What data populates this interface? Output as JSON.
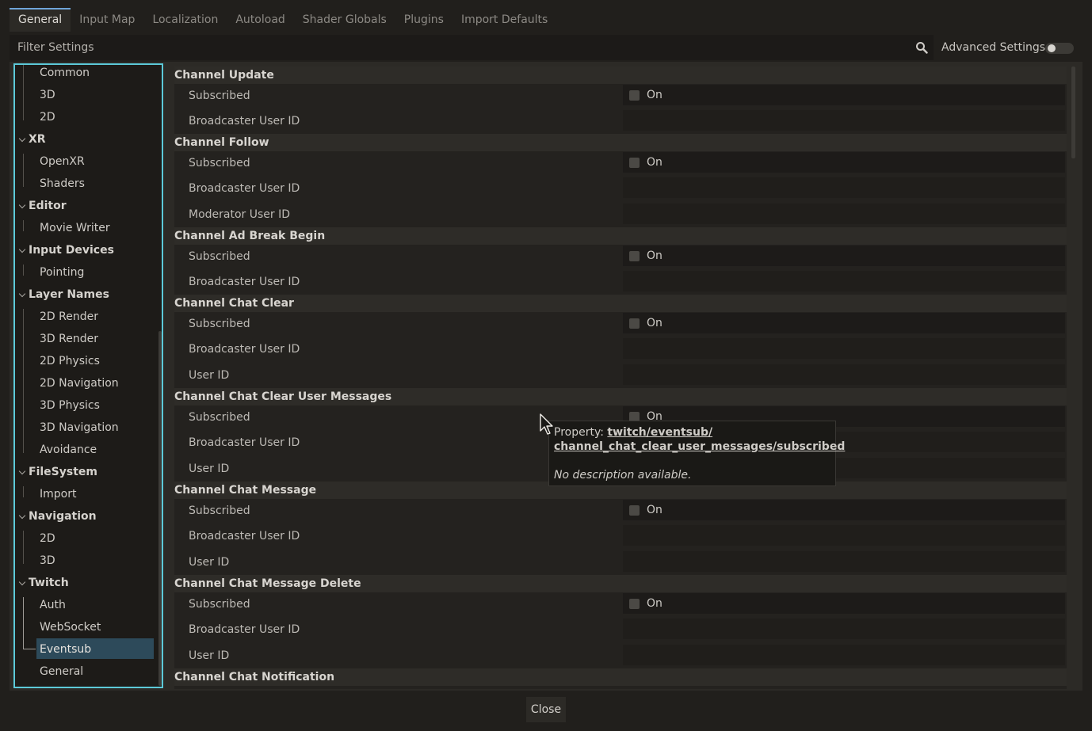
{
  "tabs": [
    {
      "label": "General",
      "active": true
    },
    {
      "label": "Input Map"
    },
    {
      "label": "Localization"
    },
    {
      "label": "Autoload"
    },
    {
      "label": "Shader Globals"
    },
    {
      "label": "Plugins"
    },
    {
      "label": "Import Defaults"
    }
  ],
  "filter": {
    "placeholder": "Filter Settings",
    "advanced_label": "Advanced Settings",
    "advanced_enabled": false
  },
  "tree": {
    "items": [
      {
        "label": "Common"
      },
      {
        "label": "3D"
      },
      {
        "label": "2D"
      },
      {
        "label": "XR"
      },
      {
        "label": "OpenXR"
      },
      {
        "label": "Shaders"
      },
      {
        "label": "Editor"
      },
      {
        "label": "Movie Writer"
      },
      {
        "label": "Input Devices"
      },
      {
        "label": "Pointing"
      },
      {
        "label": "Layer Names"
      },
      {
        "label": "2D Render"
      },
      {
        "label": "3D Render"
      },
      {
        "label": "2D Physics"
      },
      {
        "label": "2D Navigation"
      },
      {
        "label": "3D Physics"
      },
      {
        "label": "3D Navigation"
      },
      {
        "label": "Avoidance"
      },
      {
        "label": "FileSystem"
      },
      {
        "label": "Import"
      },
      {
        "label": "Navigation"
      },
      {
        "label": "2D"
      },
      {
        "label": "3D"
      },
      {
        "label": "Twitch"
      },
      {
        "label": "Auth"
      },
      {
        "label": "WebSocket"
      },
      {
        "label": "Eventsub"
      },
      {
        "label": "General"
      }
    ]
  },
  "inspector": {
    "on_label": "On",
    "sections": [
      {
        "title": "Channel Update",
        "rows": [
          "Subscribed",
          "Broadcaster User ID"
        ]
      },
      {
        "title": "Channel Follow",
        "rows": [
          "Subscribed",
          "Broadcaster User ID",
          "Moderator User ID"
        ]
      },
      {
        "title": "Channel Ad Break Begin",
        "rows": [
          "Subscribed",
          "Broadcaster User ID"
        ]
      },
      {
        "title": "Channel Chat Clear",
        "rows": [
          "Subscribed",
          "Broadcaster User ID",
          "User ID"
        ]
      },
      {
        "title": "Channel Chat Clear User Messages",
        "rows": [
          "Subscribed",
          "Broadcaster User ID",
          "User ID"
        ]
      },
      {
        "title": "Channel Chat Message",
        "rows": [
          "Subscribed",
          "Broadcaster User ID",
          "User ID"
        ]
      },
      {
        "title": "Channel Chat Message Delete",
        "rows": [
          "Subscribed",
          "Broadcaster User ID",
          "User ID"
        ]
      },
      {
        "title": "Channel Chat Notification",
        "rows": []
      }
    ]
  },
  "tooltip": {
    "prefix": "Property: ",
    "path_line1": "twitch/eventsub/",
    "path_line2": "channel_chat_clear_user_messages/subscribed",
    "description": "No description available."
  },
  "footer": {
    "close_label": "Close"
  },
  "colors": {
    "accent": "#5cc9d8",
    "selected": "#2d4a5a",
    "background": "#211f1c"
  }
}
